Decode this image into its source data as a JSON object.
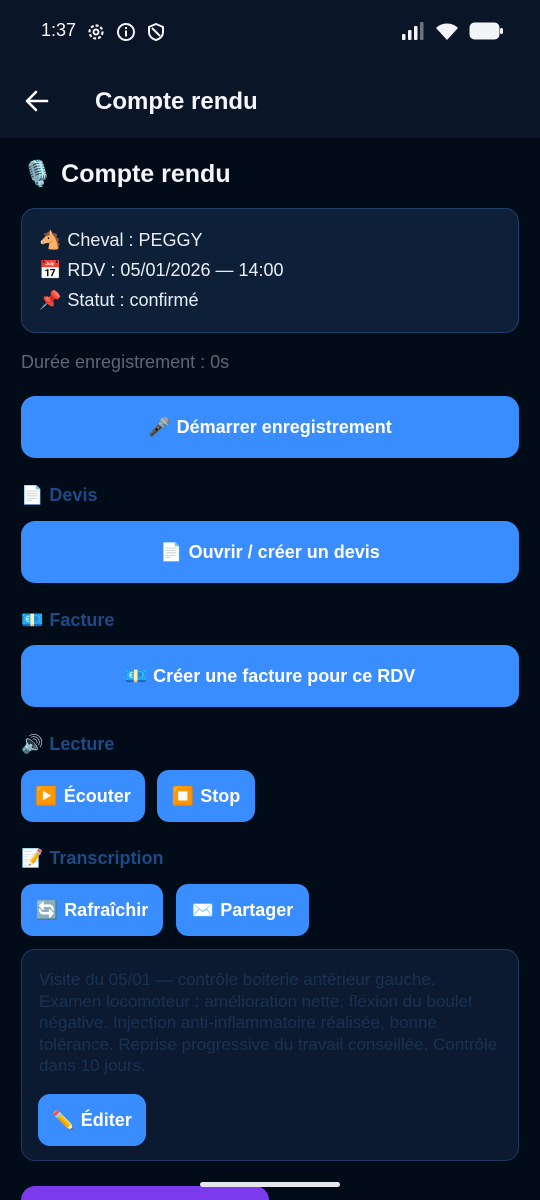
{
  "status_bar": {
    "time": "1:37"
  },
  "app_bar": {
    "title": "Compte rendu"
  },
  "section": {
    "icon": "🎙️",
    "title": "Compte rendu"
  },
  "info": {
    "horse": {
      "icon": "🐴",
      "text": "Cheval : PEGGY"
    },
    "rdv": {
      "icon": "📅",
      "text": "RDV : 05/01/2026 — 14:00"
    },
    "status": {
      "icon": "📌",
      "text": "Statut : confirmé"
    }
  },
  "recording": {
    "duration": "Durée enregistrement : 0s",
    "start_icon": "🎤",
    "start_label": "Démarrer enregistrement"
  },
  "devis": {
    "icon": "📄",
    "heading": "Devis",
    "button_icon": "📄",
    "button_label": "Ouvrir / créer un devis"
  },
  "facture": {
    "icon": "💶",
    "heading": "Facture",
    "button_icon": "💶",
    "button_label": "Créer une facture pour ce RDV"
  },
  "lecture": {
    "icon": "🔊",
    "heading": "Lecture",
    "play_icon": "▶️",
    "play_label": "Écouter",
    "stop_icon": "⏹️",
    "stop_label": "Stop"
  },
  "transcription": {
    "icon": "📝",
    "heading": "Transcription",
    "refresh_icon": "🔄",
    "refresh_label": "Rafraîchir",
    "share_icon": "✉️",
    "share_label": "Partager",
    "text": "Visite du 05/01 — contrôle boiterie antérieur gauche. Examen locomoteur : amélioration nette, flexion du boulet négative. Injection anti-inflammatoire réalisée, bonne tolérance. Reprise progressive du travail conseillée. Contrôle dans 10 jours.",
    "edit_icon": "✏️",
    "edit_label": "Éditer"
  },
  "colors": {
    "primary_button": "#3a8dff",
    "background": "#020b18",
    "bar": "#0a1628"
  }
}
